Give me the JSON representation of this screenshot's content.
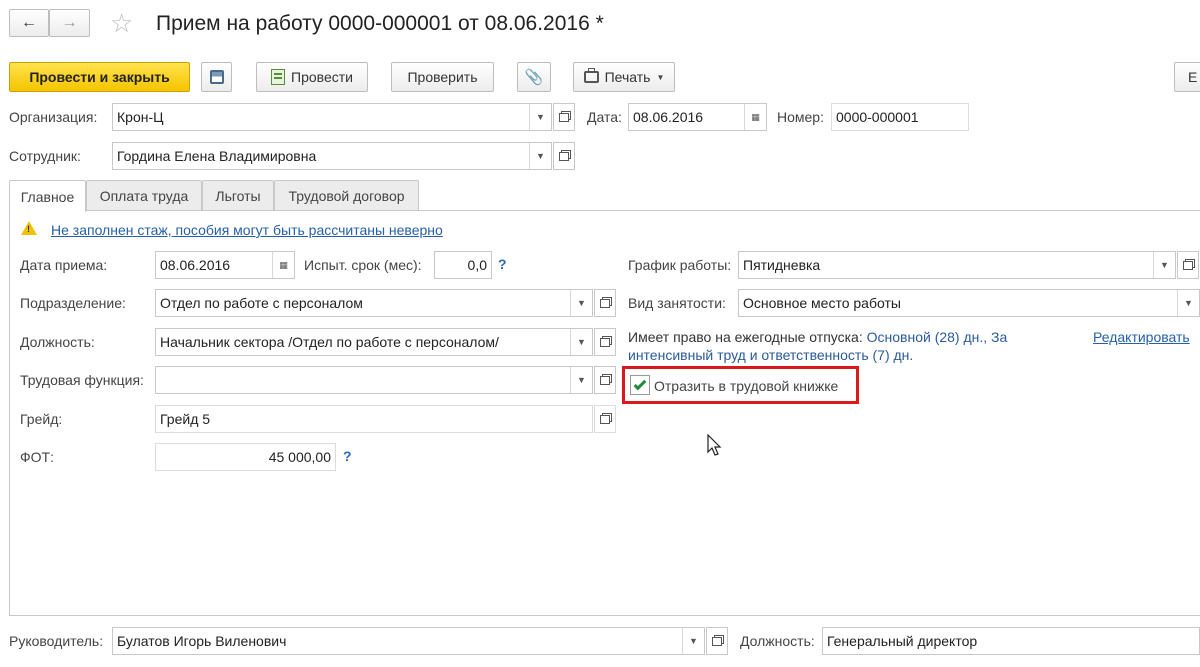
{
  "header": {
    "title": "Прием на работу 0000-000001 от 08.06.2016 *"
  },
  "toolbar": {
    "post_close": "Провести и закрыть",
    "post": "Провести",
    "check": "Проверить",
    "print": "Печать",
    "more": "Е"
  },
  "form": {
    "org_label": "Организация:",
    "org_value": "Крон-Ц",
    "date_label": "Дата:",
    "date_value": "08.06.2016",
    "number_label": "Номер:",
    "number_value": "0000-000001",
    "employee_label": "Сотрудник:",
    "employee_value": "Гордина Елена Владимировна"
  },
  "tabs": [
    "Главное",
    "Оплата труда",
    "Льготы",
    "Трудовой договор"
  ],
  "main": {
    "warning": "Не заполнен стаж, пособия могут быть рассчитаны неверно",
    "hire_date_label": "Дата приема:",
    "hire_date_value": "08.06.2016",
    "probation_label": "Испыт. срок (мес):",
    "probation_value": "0,0",
    "dept_label": "Подразделение:",
    "dept_value": "Отдел по работе с персоналом",
    "position_label": "Должность:",
    "position_value": "Начальник сектора /Отдел по работе с персоналом/",
    "function_label": "Трудовая функция:",
    "function_value": "",
    "grade_label": "Грейд:",
    "grade_value": "Грейд 5",
    "fot_label": "ФОТ:",
    "fot_value": "45 000,00",
    "help_mark": "?",
    "schedule_label": "График работы:",
    "schedule_value": "Пятидневка",
    "employment_label": "Вид занятости:",
    "employment_value": "Основное место работы",
    "vacation_prefix": "Имеет право на ежегодные отпуска:",
    "vacation_line1": "Основной (28) дн., За",
    "vacation_line2": "интенсивный труд и ответственность (7) дн.",
    "edit_link": "Редактировать",
    "workbook_label": "Отразить в трудовой книжке",
    "workbook_checked": true
  },
  "footer": {
    "manager_label": "Руководитель:",
    "manager_value": "Булатов Игорь Виленович",
    "manager_position_label": "Должность:",
    "manager_position_value": "Генеральный директор"
  },
  "colors": {
    "highlight_box": "#d9191c",
    "primary_button": "#f5c400",
    "link": "#2660a8",
    "checkmark": "#1f8a3a"
  }
}
